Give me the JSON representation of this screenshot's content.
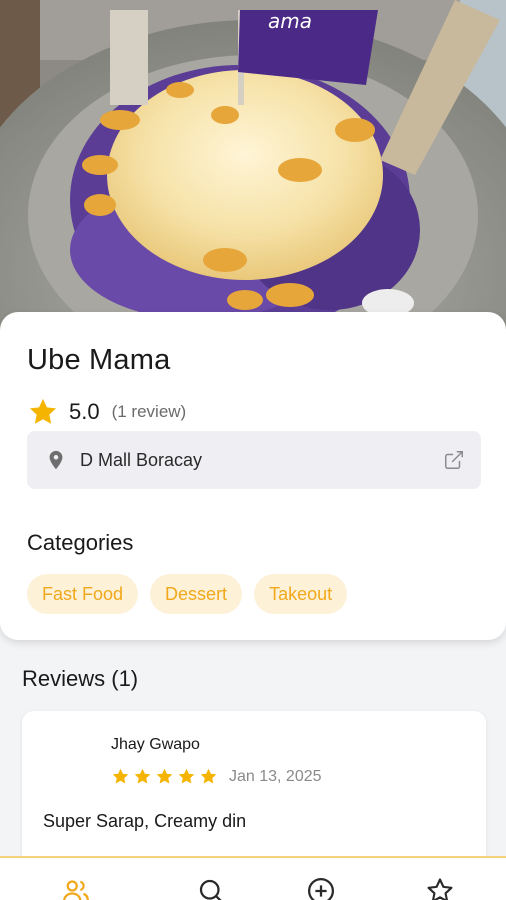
{
  "place": {
    "name": "Ube Mama",
    "rating": "5.0",
    "review_count": "(1 review)",
    "location": "D Mall Boracay",
    "flag_text": "ama"
  },
  "categories": {
    "title": "Categories",
    "items": [
      "Fast Food",
      "Dessert",
      "Takeout"
    ]
  },
  "reviews": {
    "title": "Reviews (1)",
    "items": [
      {
        "author": "Jhay Gwapo",
        "stars": 5,
        "date": "Jan 13, 2025",
        "text": "Super Sarap, Creamy din"
      }
    ]
  },
  "nav": {
    "items": [
      {
        "icon": "users-icon",
        "active": true
      },
      {
        "icon": "search-icon",
        "active": false
      },
      {
        "icon": "plus-circle-icon",
        "active": false
      },
      {
        "icon": "star-icon",
        "active": false
      }
    ]
  },
  "colors": {
    "accent": "#f2a81b",
    "chip_bg": "#fdf1d8",
    "ube_purple": "#5b3d96",
    "star": "#f4b400"
  }
}
